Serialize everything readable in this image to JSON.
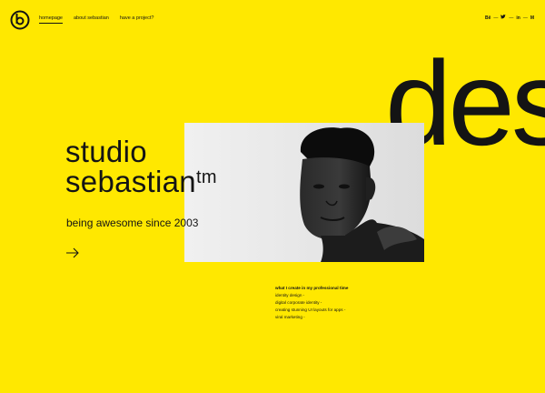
{
  "nav": {
    "items": [
      {
        "label": "homepage",
        "active": true
      },
      {
        "label": "about sebastian",
        "active": false
      },
      {
        "label": "have a project?",
        "active": false
      }
    ]
  },
  "social": {
    "icons": [
      "behance-icon",
      "twitter-icon",
      "linkedin-icon",
      "medium-icon"
    ],
    "labels": [
      "Bē",
      "🐦",
      "in",
      "M"
    ],
    "separator": "—"
  },
  "hero": {
    "background_text": "des",
    "title_line1": "studio",
    "title_line2": "sebastian",
    "title_mark": "tm",
    "tagline": "being awesome since 2003"
  },
  "services": {
    "heading": "what I create in my professional time",
    "items": [
      "identity design -",
      "digital corporate identity -",
      "creating stunning UI layouts for apps -",
      "viral marketing -"
    ]
  },
  "colors": {
    "background": "#ffe800",
    "ink": "#141414"
  }
}
